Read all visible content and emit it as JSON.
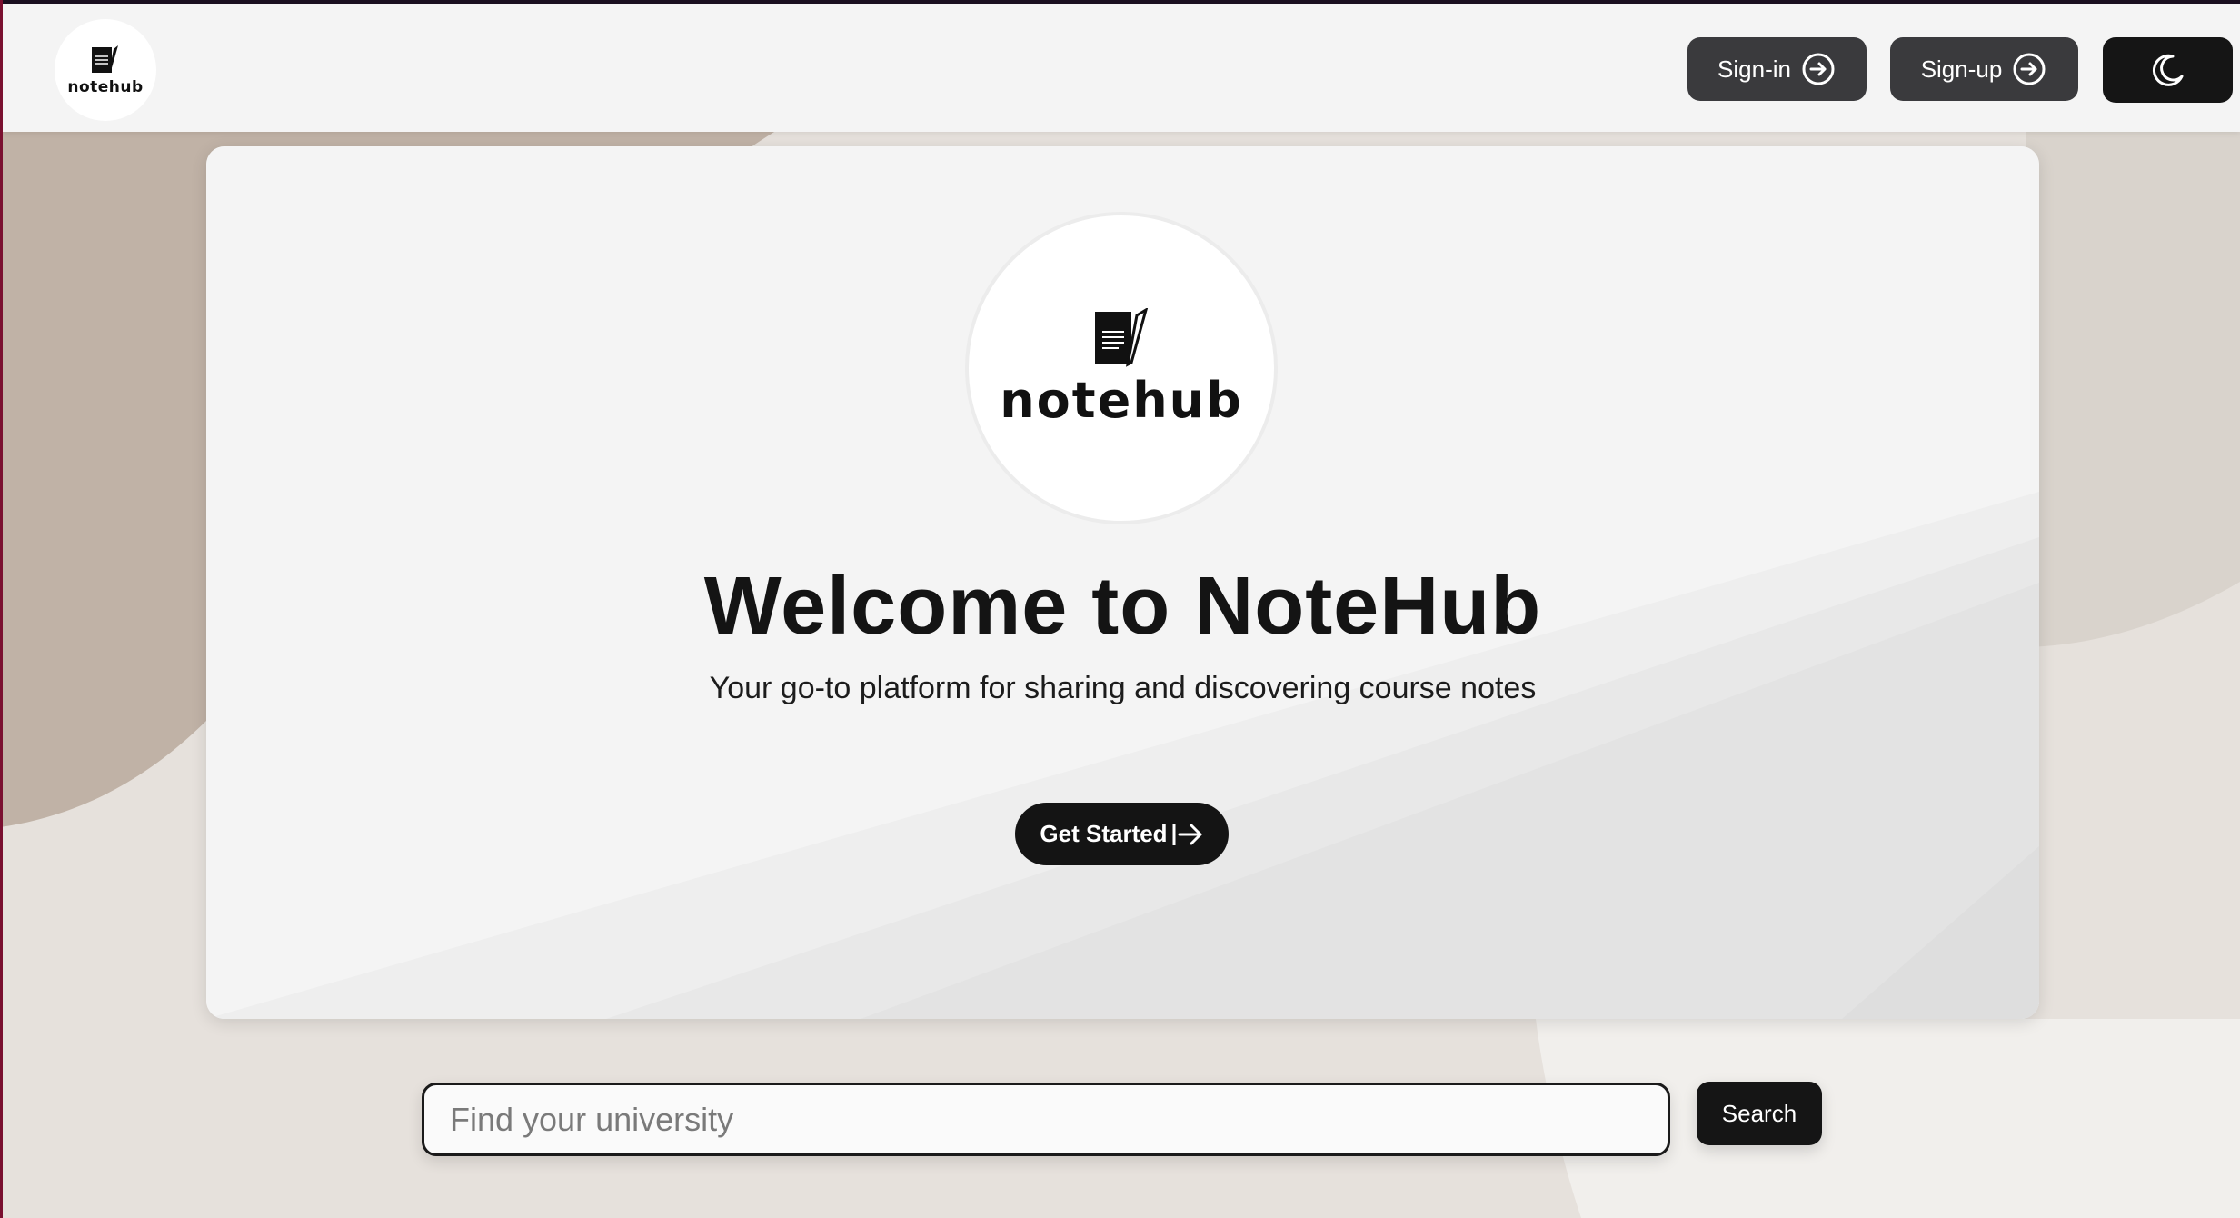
{
  "colors": {
    "accent": "#141414",
    "nav_button": "#3a3a3d",
    "card_background": "#f4f4f4",
    "page_blob": "#c0b2a6"
  },
  "header": {
    "logo_text": "notehub",
    "logo_icon": "notepad-pen-icon",
    "signin_label": "Sign-in",
    "signin_icon": "circle-arrow-right-icon",
    "signup_label": "Sign-up",
    "signup_icon": "circle-arrow-right-icon",
    "theme_icon": "moon-icon"
  },
  "hero": {
    "logo_text": "notehub",
    "title": "Welcome to NoteHub",
    "subtitle": "Your go-to platform for sharing and discovering course notes",
    "cta_label": "Get Started",
    "cta_icon": "arrow-right-icon"
  },
  "search": {
    "placeholder": "Find your university",
    "value": "",
    "button_label": "Search"
  }
}
